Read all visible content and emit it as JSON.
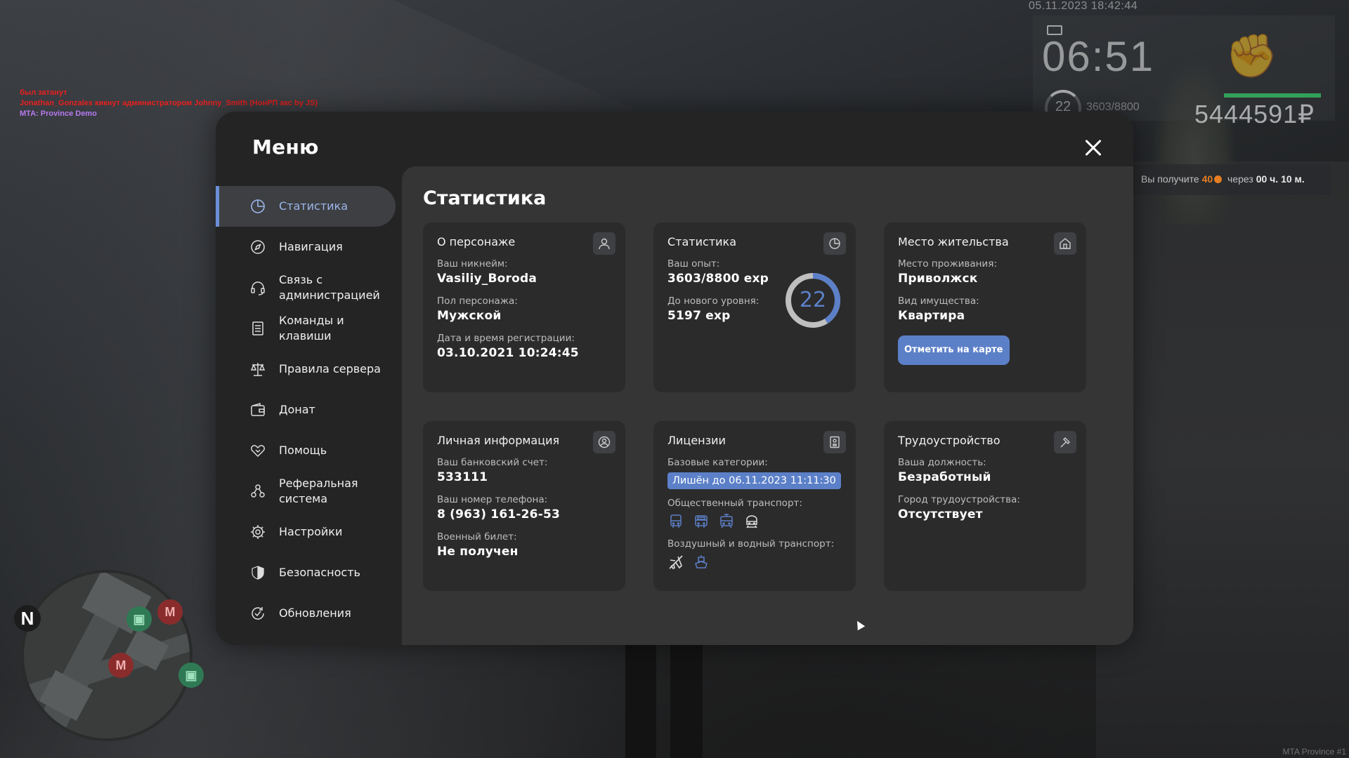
{
  "hud": {
    "datetime": "05.11.2023 18:42:44",
    "time": "06:51",
    "level": "22",
    "exp": "3603/8800",
    "money": "5444591₽",
    "reward_prefix": "Вы получите",
    "reward_amount": "40",
    "reward_mid": "через",
    "reward_time": "00 ч. 10 м.",
    "server": "MTA Province #1",
    "health_color": "#32a05a",
    "icons": [
      "mail-icon",
      "fist-icon"
    ]
  },
  "chat": {
    "lines": [
      " был затанут",
      "Jonathan_Gonzales кикнут администратором Johnny_Smith (НонРП акс by JS)",
      "MTA: Province Demo"
    ]
  },
  "minimap": {
    "north": "N",
    "metro_label": "M"
  },
  "menu": {
    "title": "Меню",
    "active_index": 0,
    "items": [
      {
        "label": "Статистика",
        "icon": "pie-chart-icon"
      },
      {
        "label": "Навигация",
        "icon": "compass-icon"
      },
      {
        "label": "Связь с администрацией",
        "icon": "headset-icon"
      },
      {
        "label": "Команды и клавиши",
        "icon": "document-icon"
      },
      {
        "label": "Правила сервера",
        "icon": "scales-icon"
      },
      {
        "label": "Донат",
        "icon": "wallet-icon"
      },
      {
        "label": "Помощь",
        "icon": "handshake-icon"
      },
      {
        "label": "Реферальная система",
        "icon": "referral-icon"
      },
      {
        "label": "Настройки",
        "icon": "gear-icon"
      },
      {
        "label": "Безопасность",
        "icon": "shield-icon"
      },
      {
        "label": "Обновления",
        "icon": "update-icon"
      }
    ]
  },
  "stats": {
    "title": "Статистика",
    "character": {
      "title": "О персонаже",
      "nick_label": "Ваш никнейм:",
      "nick": "Vasiliy_Boroda",
      "gender_label": "Пол персонажа:",
      "gender": "Мужской",
      "reg_label": "Дата и время регистрации:",
      "reg": "03.10.2021 10:24:45"
    },
    "statistics": {
      "title": "Статистика",
      "exp_label": "Ваш опыт:",
      "exp": "3603/8800 exp",
      "next_label": "До нового уровня:",
      "next": "5197 exp",
      "level": "22",
      "progress": 0.4094
    },
    "residence": {
      "title": "Место жительства",
      "place_label": "Место проживания:",
      "place": "Приволжск",
      "property_label": "Вид имущества:",
      "property": "Квартира",
      "button": "Отметить на карте"
    },
    "personal": {
      "title": "Личная информация",
      "bank_label": "Ваш банковский счет:",
      "bank": "533111",
      "phone_label": "Ваш номер телефона:",
      "phone": "8 (963) 161-26-53",
      "military_label": "Военный билет:",
      "military": "Не получен"
    },
    "licenses": {
      "title": "Лицензии",
      "basic_label": "Базовые категории:",
      "basic_status": "Лишён до 06.11.2023 11:11:30",
      "public_label": "Общественный транспорт:",
      "public_icons": [
        "bus-icon",
        "trolleybus-icon",
        "tram-icon",
        "metro-icon"
      ],
      "air_label": "Воздушный и водный транспорт:",
      "air_icons": [
        "plane-icon",
        "boat-icon"
      ]
    },
    "employment": {
      "title": "Трудоустройство",
      "position_label": "Ваша должность:",
      "position": "Безработный",
      "city_label": "Город трудоустройства:",
      "city": "Отсутствует"
    }
  },
  "colors": {
    "accent": "#5c80c8",
    "modal_bg": "#242424",
    "content_bg": "#353535",
    "card_bg": "#2b2b2b"
  }
}
